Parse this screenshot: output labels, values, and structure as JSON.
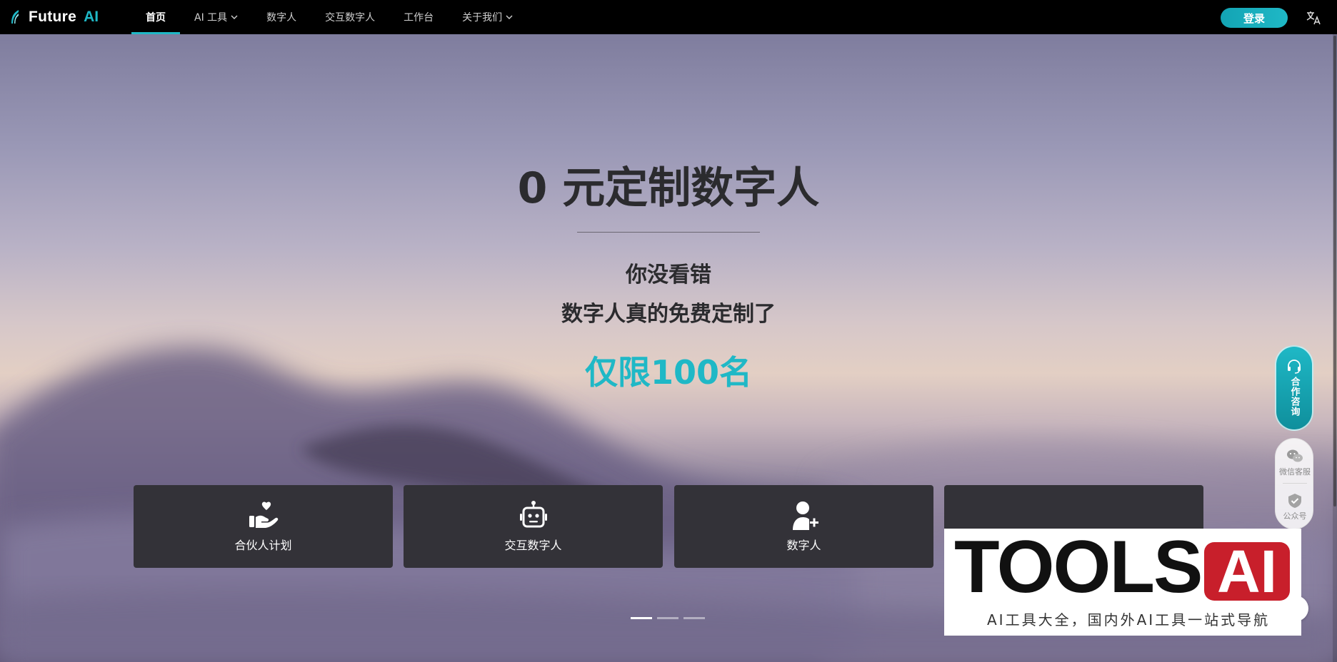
{
  "brand": {
    "name": "Future",
    "accent": "AI",
    "accent_color": "#1fb8c6"
  },
  "nav": {
    "items": [
      {
        "label": "首页",
        "active": true,
        "dropdown": false
      },
      {
        "label": "AI 工具",
        "active": false,
        "dropdown": true
      },
      {
        "label": "数字人",
        "active": false,
        "dropdown": false
      },
      {
        "label": "交互数字人",
        "active": false,
        "dropdown": false
      },
      {
        "label": "工作台",
        "active": false,
        "dropdown": false
      },
      {
        "label": "关于我们",
        "active": false,
        "dropdown": true
      }
    ],
    "login_label": "登录",
    "language_icon": "translate-icon"
  },
  "hero": {
    "title": "0 元定制数字人",
    "line1": "你没看错",
    "line2": "数字人真的免费定制了",
    "highlight": "仅限100名"
  },
  "cards": [
    {
      "label": "合伙人计划",
      "icon": "hand-heart-icon"
    },
    {
      "label": "交互数字人",
      "icon": "robot-icon"
    },
    {
      "label": "数字人",
      "icon": "add-user-icon"
    }
  ],
  "carousel": {
    "total": 3,
    "active_index": 0
  },
  "side": {
    "consult_label": "合作咨询",
    "wechat_label": "微信客服",
    "official_label": "公众号"
  },
  "watermark": {
    "title": "TOOLS",
    "badge": "AI",
    "subtitle": "AI工具大全，国内外AI工具一站式导航",
    "badge_color": "#c81f2b"
  }
}
